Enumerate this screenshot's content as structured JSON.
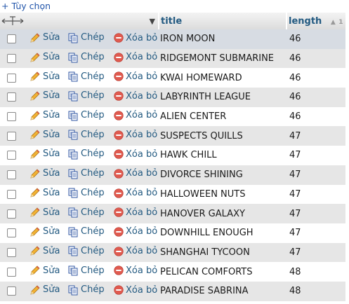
{
  "toolbar": {
    "options_label": "+ Tùy chọn"
  },
  "columns": [
    {
      "label": "title"
    },
    {
      "label": "length"
    }
  ],
  "actions": {
    "edit": "Sửa",
    "copy": "Chép",
    "delete": "Xóa bỏ"
  },
  "colors": {
    "link": "#235a81",
    "delete_icon": "#e05a4f",
    "row_alt": "#e6e6e6",
    "row_highlight": "#d7dce3"
  },
  "rows": [
    {
      "title": "IRON MOON",
      "length": "46"
    },
    {
      "title": "RIDGEMONT SUBMARINE",
      "length": "46"
    },
    {
      "title": "KWAI HOMEWARD",
      "length": "46"
    },
    {
      "title": "LABYRINTH LEAGUE",
      "length": "46"
    },
    {
      "title": "ALIEN CENTER",
      "length": "46"
    },
    {
      "title": "SUSPECTS QUILLS",
      "length": "47"
    },
    {
      "title": "HAWK CHILL",
      "length": "47"
    },
    {
      "title": "DIVORCE SHINING",
      "length": "47"
    },
    {
      "title": "HALLOWEEN NUTS",
      "length": "47"
    },
    {
      "title": "HANOVER GALAXY",
      "length": "47"
    },
    {
      "title": "DOWNHILL ENOUGH",
      "length": "47"
    },
    {
      "title": "SHANGHAI TYCOON",
      "length": "47"
    },
    {
      "title": "PELICAN COMFORTS",
      "length": "48"
    },
    {
      "title": "PARADISE SABRINA",
      "length": "48"
    }
  ]
}
